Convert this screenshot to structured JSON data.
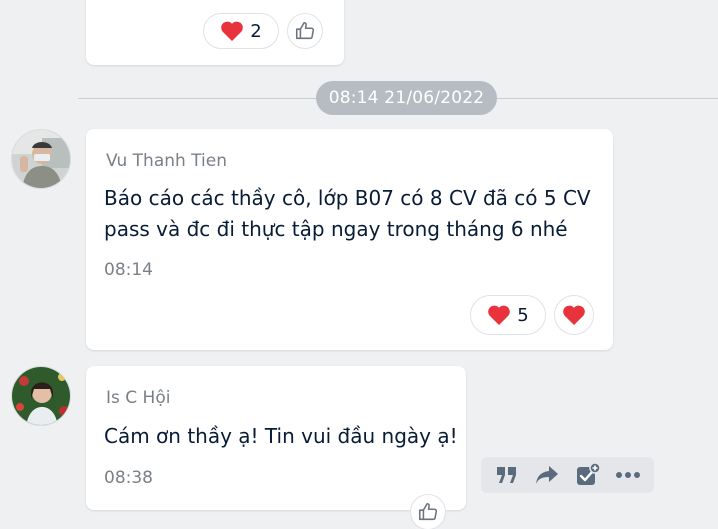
{
  "previous_message": {
    "reactions": {
      "heart_count": "2"
    }
  },
  "time_divider": {
    "label": "08:14 21/06/2022"
  },
  "messages": [
    {
      "sender": "Vu Thanh Tien",
      "lines": [
        "Báo cáo các thầy cô, lớp B07 có 8 CV đã có 5 CV",
        "pass và đc đi thực tập ngay trong tháng 6 nhé"
      ],
      "time": "08:14",
      "reactions": {
        "heart_count": "5"
      }
    },
    {
      "sender": "Is C Hội",
      "lines": [
        "Cám ơn thầy ạ! Tin vui đầu ngày ạ!"
      ],
      "time": "08:38"
    }
  ],
  "colors": {
    "heart": "#e8323c",
    "chip_bg": "#b7bcc3",
    "toolbar_icon": "#5a6b7d"
  },
  "toolbar_icons": [
    "quote-icon",
    "share-icon",
    "add-task-icon",
    "more-icon"
  ]
}
